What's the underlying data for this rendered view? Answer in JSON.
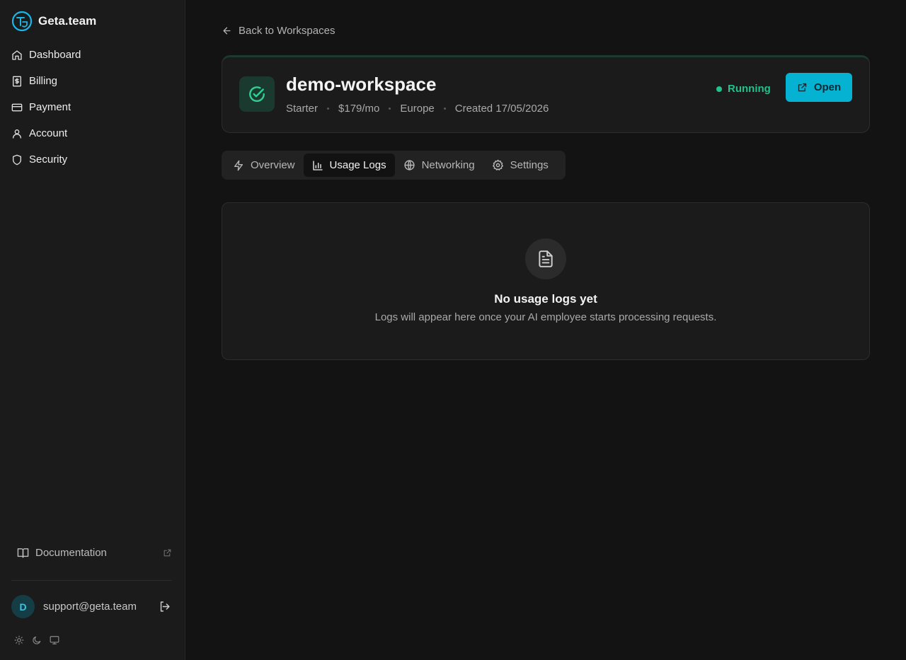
{
  "brand": {
    "name": "Geta.team",
    "logo_icon": "geta-logo-icon",
    "accent": "#1ab6e6"
  },
  "sidebar": {
    "items": [
      {
        "label": "Dashboard",
        "icon": "home-icon"
      },
      {
        "label": "Billing",
        "icon": "receipt-dollar-icon"
      },
      {
        "label": "Payment",
        "icon": "credit-card-icon"
      },
      {
        "label": "Account",
        "icon": "user-icon"
      },
      {
        "label": "Security",
        "icon": "shield-icon"
      }
    ],
    "documentation": {
      "label": "Documentation",
      "icon": "book-open-icon",
      "external_icon": "external-link-icon"
    },
    "user": {
      "avatar_initial": "D",
      "email": "support@geta.team",
      "logout_icon": "log-out-icon"
    },
    "theme_icons": [
      "sun-icon",
      "moon-icon",
      "monitor-icon"
    ]
  },
  "main": {
    "back_link": "Back to Workspaces",
    "workspace": {
      "name": "demo-workspace",
      "plan": "Starter",
      "price": "$179/mo",
      "region": "Europe",
      "created": "Created 17/05/2026",
      "status": "Running",
      "status_color": "#22c08a",
      "open_label": "Open",
      "open_color": "#06b2d1"
    },
    "tabs": [
      {
        "label": "Overview",
        "icon": "zap-icon",
        "active": false
      },
      {
        "label": "Usage Logs",
        "icon": "bar-chart-icon",
        "active": true
      },
      {
        "label": "Networking",
        "icon": "globe-icon",
        "active": false
      },
      {
        "label": "Settings",
        "icon": "gear-icon",
        "active": false
      }
    ],
    "empty_state": {
      "icon": "file-text-icon",
      "title": "No usage logs yet",
      "subtitle": "Logs will appear here once your AI employee starts processing requests."
    }
  }
}
